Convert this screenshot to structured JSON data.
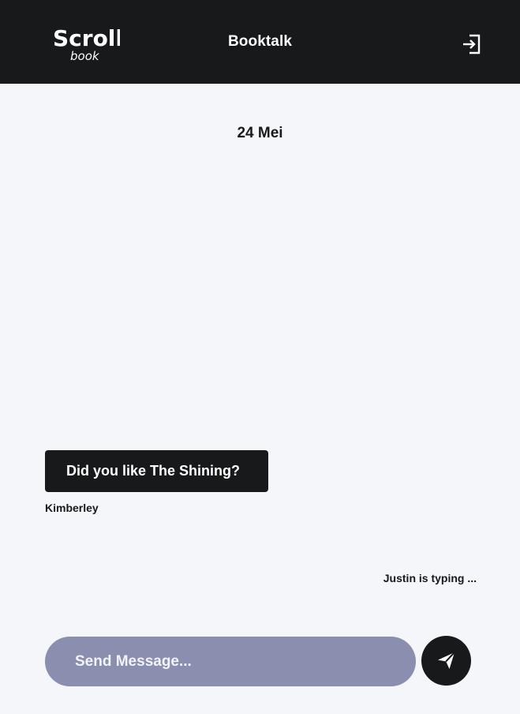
{
  "header": {
    "logo_text": {
      "line1": "Scroll",
      "line2": "book"
    },
    "title": "Booktalk",
    "logout_icon": "logout-icon"
  },
  "chat": {
    "date": "24 Mei",
    "messages": [
      {
        "text": "Did you like The Shining?",
        "author": "Kimberley"
      }
    ],
    "typing_status": "Justin is typing ..."
  },
  "composer": {
    "placeholder": "Send Message...",
    "send_icon": "send-icon"
  },
  "colors": {
    "header_background": "#17191a",
    "page_background": "#f4f6f9",
    "message_background": "#17191a",
    "input_background": "#8a8faf",
    "text_light": "#ffffff",
    "text_dark": "#17191a"
  }
}
